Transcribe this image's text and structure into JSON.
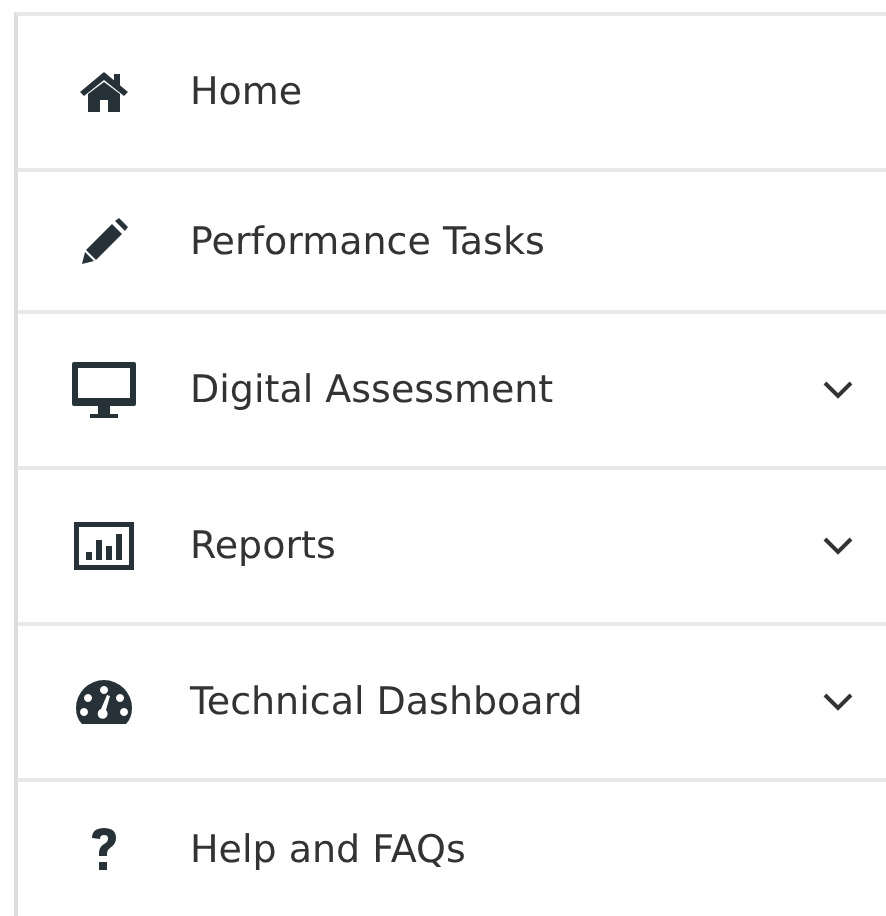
{
  "nav": {
    "items": [
      {
        "label": "Home",
        "has_submenu": false
      },
      {
        "label": "Performance Tasks",
        "has_submenu": false
      },
      {
        "label": "Digital Assessment",
        "has_submenu": true
      },
      {
        "label": "Reports",
        "has_submenu": true
      },
      {
        "label": "Technical Dashboard",
        "has_submenu": true
      },
      {
        "label": "Help and FAQs",
        "has_submenu": false
      }
    ]
  }
}
